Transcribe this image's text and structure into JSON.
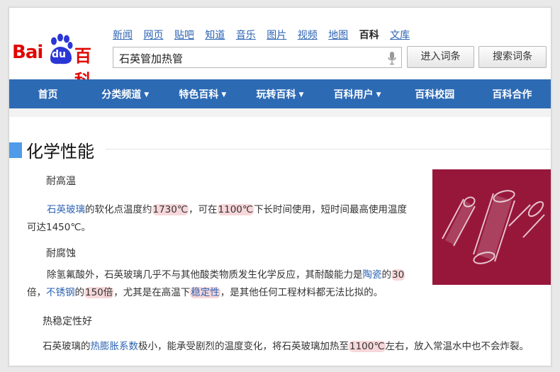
{
  "logo": {
    "left": "Bai",
    "paw_text": "du",
    "right": "百科"
  },
  "topnav": [
    {
      "label": "新闻",
      "active": false
    },
    {
      "label": "网页",
      "active": false
    },
    {
      "label": "贴吧",
      "active": false
    },
    {
      "label": "知道",
      "active": false
    },
    {
      "label": "音乐",
      "active": false
    },
    {
      "label": "图片",
      "active": false
    },
    {
      "label": "视频",
      "active": false
    },
    {
      "label": "地图",
      "active": false
    },
    {
      "label": "百科",
      "active": true
    },
    {
      "label": "文库",
      "active": false
    }
  ],
  "search": {
    "value": "石英管加热管"
  },
  "buttons": {
    "enter": "进入词条",
    "search": "搜索词条"
  },
  "mainnav": [
    {
      "label": "首页",
      "dropdown": false
    },
    {
      "label": "分类频道",
      "dropdown": true
    },
    {
      "label": "特色百科",
      "dropdown": true
    },
    {
      "label": "玩转百科",
      "dropdown": true
    },
    {
      "label": "百科用户",
      "dropdown": true
    },
    {
      "label": "百科校园",
      "dropdown": false
    },
    {
      "label": "百科合作",
      "dropdown": false
    }
  ],
  "section": {
    "title": "化学性能"
  },
  "content": {
    "heat": {
      "heading": "耐高温",
      "l1_link": "石英玻璃",
      "l1_a": "的软化点温度约",
      "l1_hl1": "1730℃",
      "l1_b": "，可在",
      "l1_hl2": "1100℃",
      "l1_c": "下长时间使用，短时间最高使用温度",
      "l2": "可达1450℃。"
    },
    "corrosion": {
      "heading": "耐腐蚀",
      "l1_a": "除氢氟酸外，石英玻璃几乎不与其他酸类物质发生化学反应，其耐酸能力是",
      "l1_link": "陶瓷",
      "l1_b": "的",
      "l1_hl": "30",
      "l2_a": "倍，",
      "l2_link": "不锈钢",
      "l2_b": "的",
      "l2_hl": "150倍",
      "l2_c": "，尤其是在高温下",
      "l2_link2": "稳定性",
      "l2_d": "，是其他任何工程材料都无法比拟的。"
    },
    "thermal": {
      "heading": "热稳定性好",
      "l1_a": "石英玻璃的",
      "l1_link": "热膨胀系数",
      "l1_b": "极小，能承受剧烈的温度变化，将石英玻璃加热至",
      "l1_hl": "1100℃",
      "l1_c": "左右，放入常温水中也不会炸裂。"
    }
  },
  "colors": {
    "brand_red": "#e10601",
    "brand_blue": "#2d6ab4",
    "link": "#2d64b3",
    "highlight": "#f7d7da",
    "photo_bg": "#97173b"
  },
  "icons": [
    "baidu-paw-icon",
    "microphone-icon",
    "caret-down-icon",
    "section-marker-icon"
  ]
}
